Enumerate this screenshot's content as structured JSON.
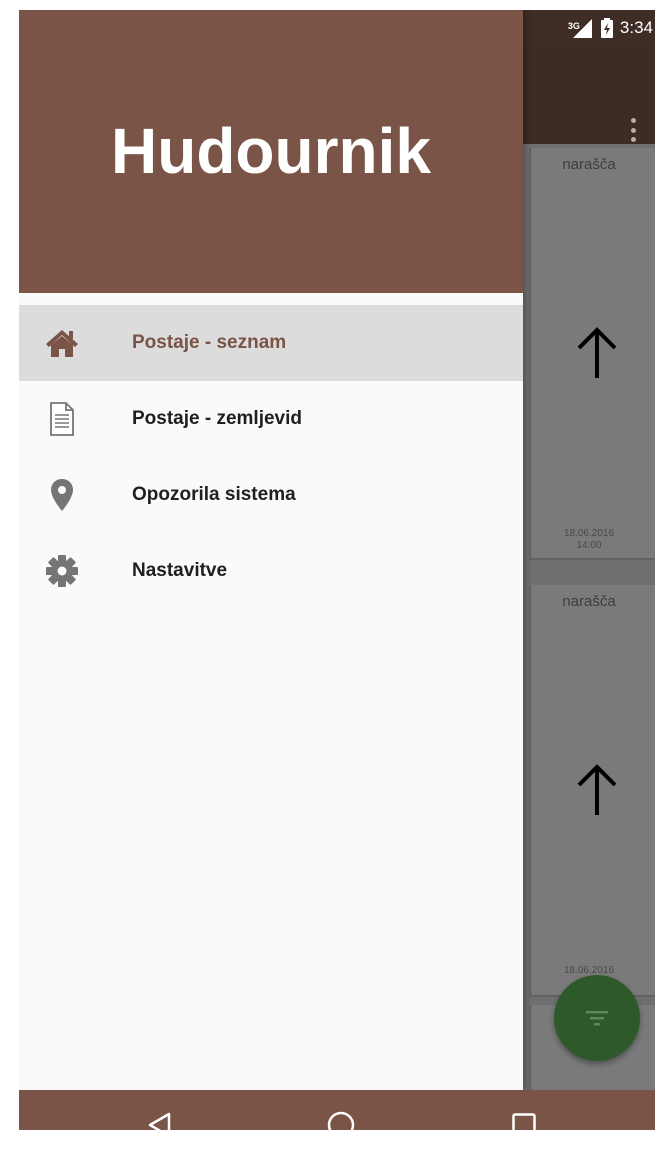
{
  "status_bar": {
    "network": "3G",
    "time": "3:34"
  },
  "drawer": {
    "title": "Hudournik",
    "items": [
      {
        "label": "Postaje - seznam",
        "icon": "home-icon",
        "active": true
      },
      {
        "label": "Postaje - zemljevid",
        "icon": "document-icon",
        "active": false
      },
      {
        "label": "Opozorila sistema",
        "icon": "location-pin-icon",
        "active": false
      },
      {
        "label": "Nastavitve",
        "icon": "gear-icon",
        "active": false
      }
    ]
  },
  "background_cards": [
    {
      "status": "narašča",
      "trend_icon": "arrow-up-icon",
      "date": "18.06.2016",
      "time": "14:00"
    },
    {
      "status": "narašča",
      "trend_icon": "arrow-up-icon",
      "date": "18.06.2016",
      "time": ""
    }
  ],
  "fab": {
    "icon": "filter-icon"
  },
  "nav_bar": {
    "buttons": [
      "back-icon",
      "home-circle-icon",
      "recents-icon"
    ]
  },
  "colors": {
    "primary": "#7a5446",
    "primary_dark": "#3e2c25",
    "accent": "#2e5a2b",
    "drawer_bg": "#fafafa",
    "active_item_bg": "#dcdcdc"
  }
}
